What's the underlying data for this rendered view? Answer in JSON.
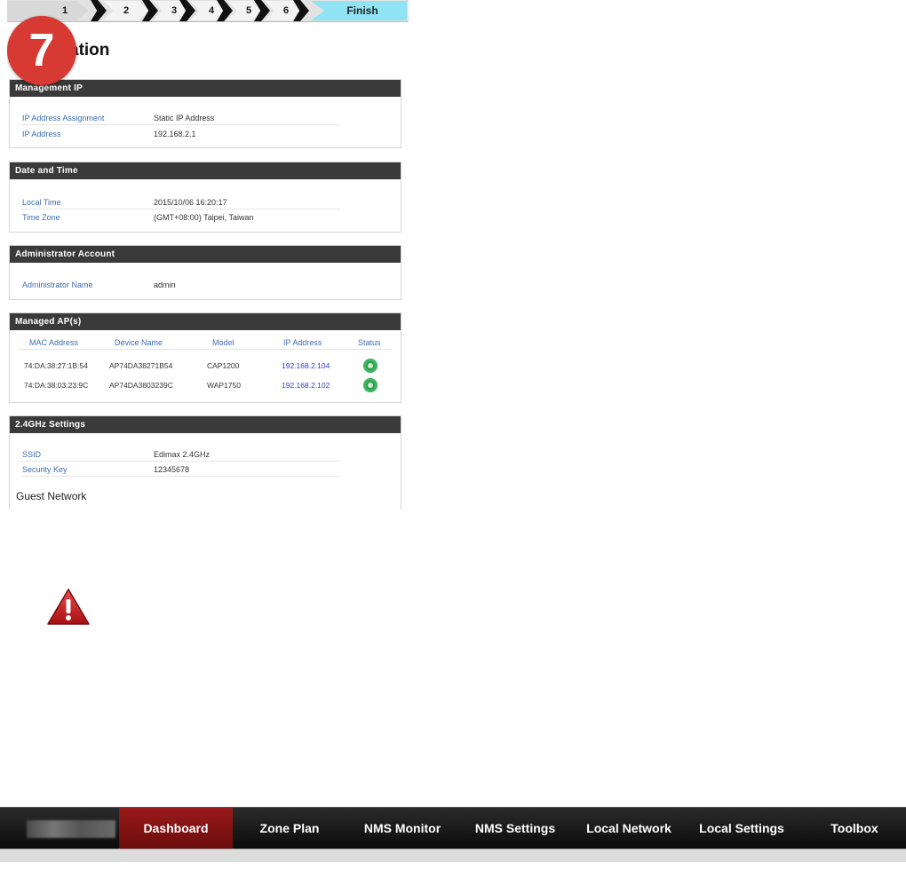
{
  "wizard": {
    "steps": [
      "1",
      "2",
      "3",
      "4",
      "5",
      "6"
    ],
    "finish_label": "Finish",
    "step_badge": "7",
    "title": "ation"
  },
  "management_ip": {
    "header": "Management IP",
    "rows": [
      {
        "label": "IP Address Assignment",
        "value": "Static IP Address"
      },
      {
        "label": "IP Address",
        "value": "192.168.2.1"
      }
    ]
  },
  "date_time": {
    "header": "Date and Time",
    "rows": [
      {
        "label": "Local Time",
        "value": "2015/10/06  16:20:17"
      },
      {
        "label": "Time Zone",
        "value": "(GMT+08:00) Taipei, Taiwan"
      }
    ]
  },
  "admin_account": {
    "header": "Administrator Account",
    "rows": [
      {
        "label": "Administrator Name",
        "value": "admin"
      }
    ]
  },
  "managed_aps": {
    "header": "Managed AP(s)",
    "columns": [
      "MAC Address",
      "Device Name",
      "Model",
      "IP Address",
      "Status"
    ],
    "rows": [
      {
        "mac": "74:DA:38:27:1B:54",
        "name": "AP74DA38271B54",
        "model": "CAP1200",
        "ip": "192.168.2.104",
        "status": "online"
      },
      {
        "mac": "74:DA:38:03:23:9C",
        "name": "AP74DA3803239C",
        "model": "WAP1750",
        "ip": "192.168.2.102",
        "status": "online"
      }
    ]
  },
  "settings_24g": {
    "header": "2.4GHz Settings",
    "rows": [
      {
        "label": "SSID",
        "value": "Edimax 2.4GHz"
      },
      {
        "label": "Security Key",
        "value": "12345678"
      }
    ],
    "guest_network_label": "Guest Network"
  },
  "warning_icon": "warning-triangle-icon",
  "nav": {
    "items": [
      {
        "label": "Dashboard",
        "active": true
      },
      {
        "label": "Zone Plan"
      },
      {
        "label": "NMS Monitor"
      },
      {
        "label": "NMS Settings"
      },
      {
        "label": "Local Network"
      },
      {
        "label": "Local Settings"
      },
      {
        "label": "Toolbox"
      }
    ]
  },
  "colors": {
    "nav_active": "#8b1414",
    "badge": "#d63a32",
    "finish_step": "#8fe3f2",
    "status_online": "#2f9b4c",
    "label_blue": "#3d6db5"
  }
}
